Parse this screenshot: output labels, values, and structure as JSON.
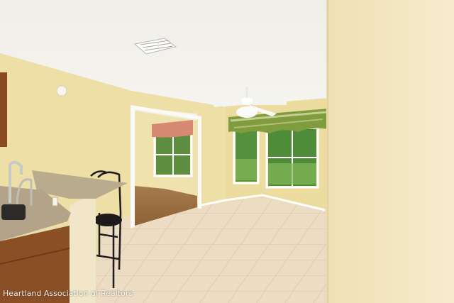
{
  "watermark": {
    "text": "Heartland Association of Realtors"
  },
  "scene": {
    "subject": "empty dining room",
    "colors": {
      "ceiling": "#f2f1ec",
      "wall": "#eedfa6",
      "wall_right": "#f3e7c4",
      "tile": "#eddcc4",
      "grout": "#d7c2a2",
      "cabinet": "#8b4f26",
      "granite": "#b7a98c",
      "curtain": "#7c9a3c",
      "window_view": "#4f8a3a"
    }
  }
}
